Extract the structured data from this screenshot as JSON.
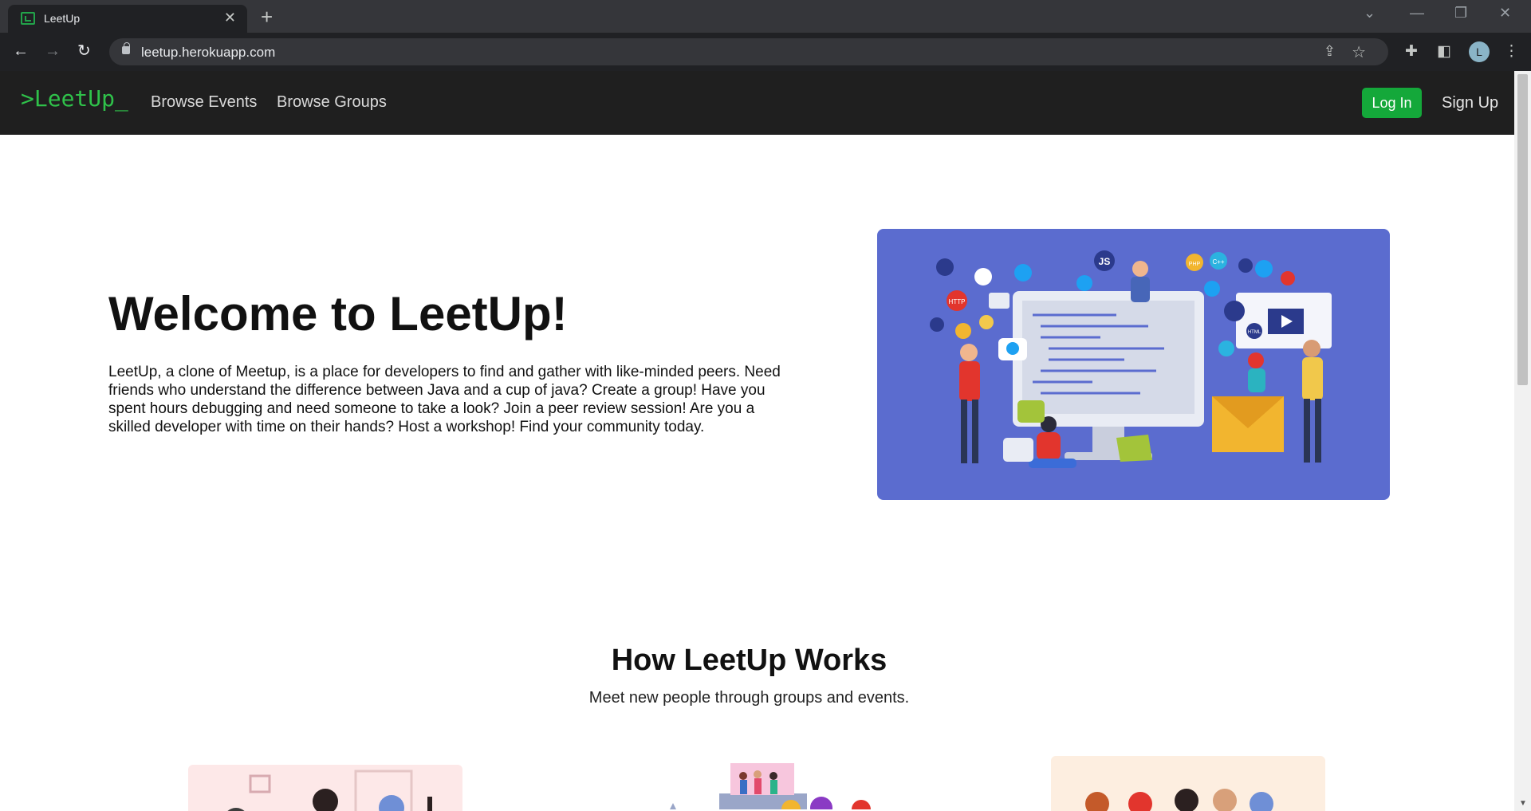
{
  "browser": {
    "tab_title": "LeetUp",
    "url": "leetup.herokuapp.com",
    "profile_initial": "L"
  },
  "site": {
    "logo": ">LeetUp_",
    "nav": {
      "browse_events": "Browse Events",
      "browse_groups": "Browse Groups",
      "login": "Log In",
      "signup": "Sign Up"
    },
    "hero": {
      "title": "Welcome to LeetUp!",
      "text": "LeetUp, a clone of Meetup, is a place for developers to find and gather with like-minded peers. Need friends who understand the difference between Java and a cup of java? Create a group! Have you spent hours debugging and need someone to take a look? Join a peer review session! Are you a skilled developer with time on their hands? Host a workshop! Find your community today.",
      "illustration_labels": [
        "JS",
        "HTTP",
        "HTML",
        "C++",
        "PHP"
      ]
    },
    "how": {
      "title": "How LeetUp Works",
      "subtitle": "Meet new people through groups and events."
    }
  },
  "colors": {
    "nav_bg": "#1f1f1f",
    "brand_green": "#2fc14a",
    "login_bg": "#14a83a",
    "hero_image_bg": "#5b6ccf"
  }
}
